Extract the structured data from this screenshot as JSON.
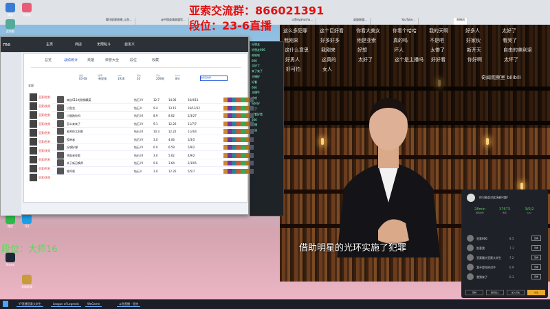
{
  "overlay": {
    "group": "亚索交流群：866021391",
    "rank": "段位：23-6直播",
    "rank2": "段位：大师16"
  },
  "browser": {
    "tabs": [
      "腾讯联赛直播_斗鱼...",
      "@中国英雄联盟官...",
      "斗鱼Ayahasha...",
      "英雄联盟...",
      "YouTube...",
      "直播间"
    ]
  },
  "bili": {
    "watermark": "奇闻观察室 bilibili",
    "subtitle": "借助明星的光环实施了犯罪",
    "danmaku": [
      "这么多犯罪",
      "这个巨好看",
      "你看大美女",
      "你看个哈哈",
      "我的天啊",
      "好多人",
      "太好了",
      "我刚来",
      "好多好多",
      "他是亚索",
      "真的吗",
      "不是吧",
      "好家伙",
      "看哭了",
      "这什么意思",
      "我刚来",
      "好想",
      "坏人",
      "太惨了",
      "新开天",
      "自由的美利坚",
      "好男人",
      "这真的",
      "太好了",
      "这个是主播吗",
      "好好看",
      "你好啊",
      "太坏了",
      "好可怕",
      "女人"
    ]
  },
  "chat": {
    "lines": [
      "好朋友",
      "好朋友666",
      "哈哈哈",
      "666",
      "太好了",
      "来了来了",
      "主播好",
      "好看",
      "666",
      "主播牛",
      "哈哈",
      "好好好",
      "来了",
      "好看好看",
      "666",
      "主播",
      "加油"
    ]
  },
  "lol": {
    "title": "me",
    "nav": [
      "主页",
      "商店",
      "无限乱斗",
      "自定义"
    ],
    "tabs": [
      "总览",
      "战绩统计",
      "英雄",
      "荣誉大全",
      "段位",
      "收藏"
    ],
    "subtabs": [
      "全部",
      "排位",
      "匹配",
      "大乱斗"
    ],
    "stats": [
      {
        "k": "战绩",
        "v": "03-08"
      },
      {
        "k": "胜率",
        "v": "单双排"
      },
      {
        "k": "KDA",
        "v": "1936"
      },
      {
        "k": "场次",
        "v": "20"
      },
      {
        "k": "评分",
        "v": "209场"
      },
      {
        "k": "MVP",
        "v": "8/4"
      }
    ],
    "search": "搜索召唤师",
    "status": "英雄联盟·在线"
  },
  "lol_rows": [
    [
      "来自S11的锐钢精英",
      "钻石 IV",
      "12.7",
      "14.06",
      "16/4/11"
    ],
    [
      "小鱼龙",
      "钻石 II",
      "9.4",
      "13.15",
      "16/13/12"
    ],
    [
      "小猴跑你吗",
      "钻石 III",
      "8.9",
      "8.62",
      "2/3/27"
    ],
    [
      "怎么来来了",
      "钻石 IV",
      "9.1",
      "12.20",
      "11/7/7"
    ],
    [
      "老师你太别那",
      "钻石 III",
      "10.3",
      "12.22",
      "11/4/4"
    ],
    [
      "孤单者",
      "钻石 IV",
      "3.0",
      "4.06",
      "3/3/5"
    ],
    [
      "好想好想",
      "钻石 IV",
      "6.0",
      "6.59",
      "5/9/2"
    ],
    [
      "哭起来亚索",
      "钻石 III",
      "3.0",
      "5.62",
      "4/9/2"
    ],
    [
      "关于新召唤师",
      "钻石 IV",
      "9.0",
      "3.64",
      "2/10/5"
    ],
    [
      "嗯哼呢",
      "钻石 II",
      "3.0",
      "12.26",
      "5/5/7"
    ]
  ],
  "lol_hist": [
    "亚索/胜利",
    "亚索/失败",
    "亚索/胜利",
    "亚索/失败",
    "亚索/胜利",
    "亚索/胜利",
    "亚索/失败",
    "亚索/胜利",
    "亚索/胜利",
    "亚索/失败"
  ],
  "card": {
    "title": "你可能会对此场感兴趣？",
    "stats": [
      {
        "v": "28min",
        "k": "游戏时长"
      },
      {
        "v": "37673",
        "k": "伤害"
      },
      {
        "v": "3/0/2",
        "k": "KDA"
      }
    ],
    "players": [
      [
        "亚索666",
        "8.5"
      ],
      [
        "别惹我",
        "7.3"
      ],
      [
        "亚索最大亚索大学生",
        "7.2"
      ],
      [
        "我不是你的对手",
        "6.9"
      ],
      [
        "我到来了",
        "6.3"
      ]
    ],
    "btn_view": "查看",
    "bottom": [
      "复制",
      "邀请加入",
      "加入好友",
      "关注"
    ]
  },
  "taskbar": [
    "YY直播亚索大学生",
    "League of Legends",
    "WeGame",
    "斗鱼直播 - 狂热"
  ],
  "desktop": [
    {
      "name": "桌面"
    },
    {
      "name": "回收站"
    },
    {
      "name": "此电脑"
    },
    {
      "name": "微信"
    },
    {
      "name": "QQ"
    },
    {
      "name": "Steam"
    },
    {
      "name": "英雄联盟"
    }
  ]
}
